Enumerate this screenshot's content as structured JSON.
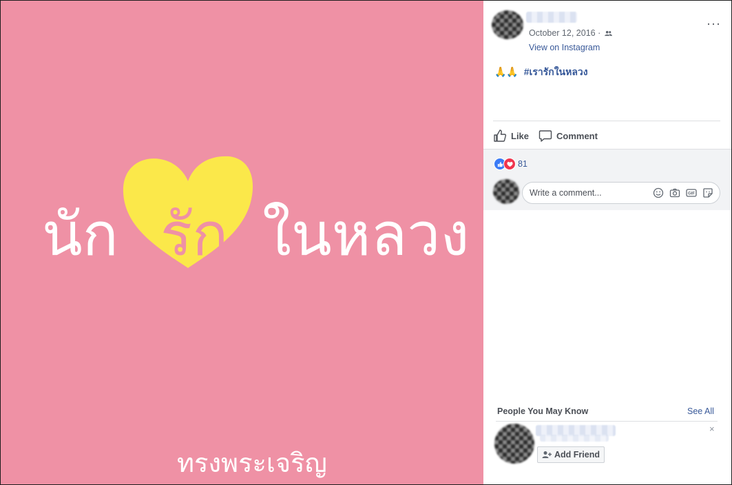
{
  "photo": {
    "title_part1": "นัก",
    "title_heart": "รัก",
    "title_part2": "ในหลวง",
    "subtitle": "ทรงพระเจริญ",
    "colors": {
      "background": "#ef91a5",
      "heart": "#fbe84a",
      "text": "#ffffff"
    }
  },
  "post": {
    "date": "October 12, 2016 ·",
    "view_on_instagram": "View on Instagram",
    "more_label": "···",
    "caption_emoji": "🙏🙏",
    "caption_hashtag": "#เรารักในหลวง"
  },
  "actions": {
    "like_label": "Like",
    "comment_label": "Comment"
  },
  "feedback": {
    "reaction_count": "81",
    "comment_placeholder": "Write a comment...",
    "gif_label": "GIF"
  },
  "pymk": {
    "title": "People You May Know",
    "see_all": "See All",
    "close": "×",
    "add_friend_label": "Add Friend"
  },
  "colors": {
    "link": "#385898",
    "muted": "#606770",
    "panel_bg": "#f2f3f5",
    "like_blue": "#3b7bf6",
    "love_red": "#f0354e"
  }
}
